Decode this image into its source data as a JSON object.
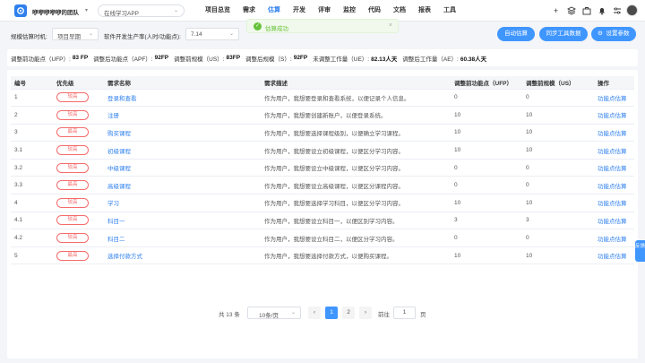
{
  "header": {
    "team_name": "咿咿咿咿咿的团队",
    "app_select": "在线学习APP",
    "nav": [
      "项目总览",
      "需求",
      "估算",
      "开发",
      "评审",
      "监控",
      "代码",
      "文档",
      "报表",
      "工具"
    ],
    "active_nav": "估算"
  },
  "toast": {
    "message": "估算成功"
  },
  "filters": {
    "timing_label": "规模估算时机:",
    "timing_value": "项目早期",
    "productivity_label": "软件开发生产率(人时/功能点):",
    "productivity_value": "7.14",
    "buttons": [
      "自动估算",
      "同步工具数据",
      "设置参数"
    ]
  },
  "metrics": [
    {
      "label": "调整前功能点（UFP）:",
      "value": "83 FP"
    },
    {
      "label": "调整后功能点（APF）:",
      "value": "92FP"
    },
    {
      "label": "调整前规模（US）:",
      "value": "83FP"
    },
    {
      "label": "调整后规模（S）:",
      "value": "92FP"
    },
    {
      "label": "未调整工作量（UE）:",
      "value": "82.13人天"
    },
    {
      "label": "调整后工作量（AE）:",
      "value": "60.38人天"
    }
  ],
  "table": {
    "columns": [
      "编号",
      "优先级",
      "需求名称",
      "需求描述",
      "调整前功能点（UFP）",
      "调整前规模（US）",
      "操作"
    ],
    "rows": [
      {
        "id": "1",
        "priority": "较高",
        "name": "登录和查看",
        "desc": "作为用户，我想要登录和查看系统，以便记录个人信息。",
        "ufp": "0",
        "us": "0",
        "action": "功能点估算"
      },
      {
        "id": "2",
        "priority": "较高",
        "name": "注册",
        "desc": "作为用户，我想要创建新账户，以便登录系统。",
        "ufp": "10",
        "us": "10",
        "action": "功能点估算"
      },
      {
        "id": "3",
        "priority": "最高",
        "name": "购买课程",
        "desc": "作为用户，我想要选择课程级别，以便确立学习课程。",
        "ufp": "10",
        "us": "10",
        "action": "功能点估算"
      },
      {
        "id": "3.1",
        "priority": "较高",
        "name": "初级课程",
        "desc": "作为用户，我想要设立初级课程，以便区分学习内容。",
        "ufp": "10",
        "us": "10",
        "action": "功能点估算"
      },
      {
        "id": "3.2",
        "priority": "较高",
        "name": "中级课程",
        "desc": "作为用户，我想要设立中级课程，以便区分学习内容。",
        "ufp": "0",
        "us": "0",
        "action": "功能点估算"
      },
      {
        "id": "3.3",
        "priority": "最高",
        "name": "高级课程",
        "desc": "作为用户，我想要设立高级课程，以便区分课程内容。",
        "ufp": "0",
        "us": "0",
        "action": "功能点估算"
      },
      {
        "id": "4",
        "priority": "较高",
        "name": "学习",
        "desc": "作为用户，我想要选择学习科目，以便区分学习内容。",
        "ufp": "10",
        "us": "10",
        "action": "功能点估算"
      },
      {
        "id": "4.1",
        "priority": "较高",
        "name": "科目一",
        "desc": "作为用户，我想要设立科目一，以便区别学习内容。",
        "ufp": "3",
        "us": "3",
        "action": "功能点估算"
      },
      {
        "id": "4.2",
        "priority": "较高",
        "name": "科目二",
        "desc": "作为用户，我想要设立科目二，以便区分学习内容。",
        "ufp": "0",
        "us": "0",
        "action": "功能点估算"
      },
      {
        "id": "5",
        "priority": "最高",
        "name": "选择付款方式",
        "desc": "作为用户，我想要选择付款方式，以便购买课程。",
        "ufp": "10",
        "us": "10",
        "action": "功能点估算"
      }
    ]
  },
  "pagination": {
    "total": "共 13 条",
    "page_size": "10条/页",
    "pages": [
      "1",
      "2"
    ],
    "current": "1",
    "goto_label": "前往",
    "goto_value": "1",
    "goto_unit": "页"
  },
  "side_tab": "反馈",
  "colors": {
    "primary": "#4096ff",
    "accent": "#2f80ed",
    "priority": "#f56c6c",
    "success": "#67c23a"
  }
}
